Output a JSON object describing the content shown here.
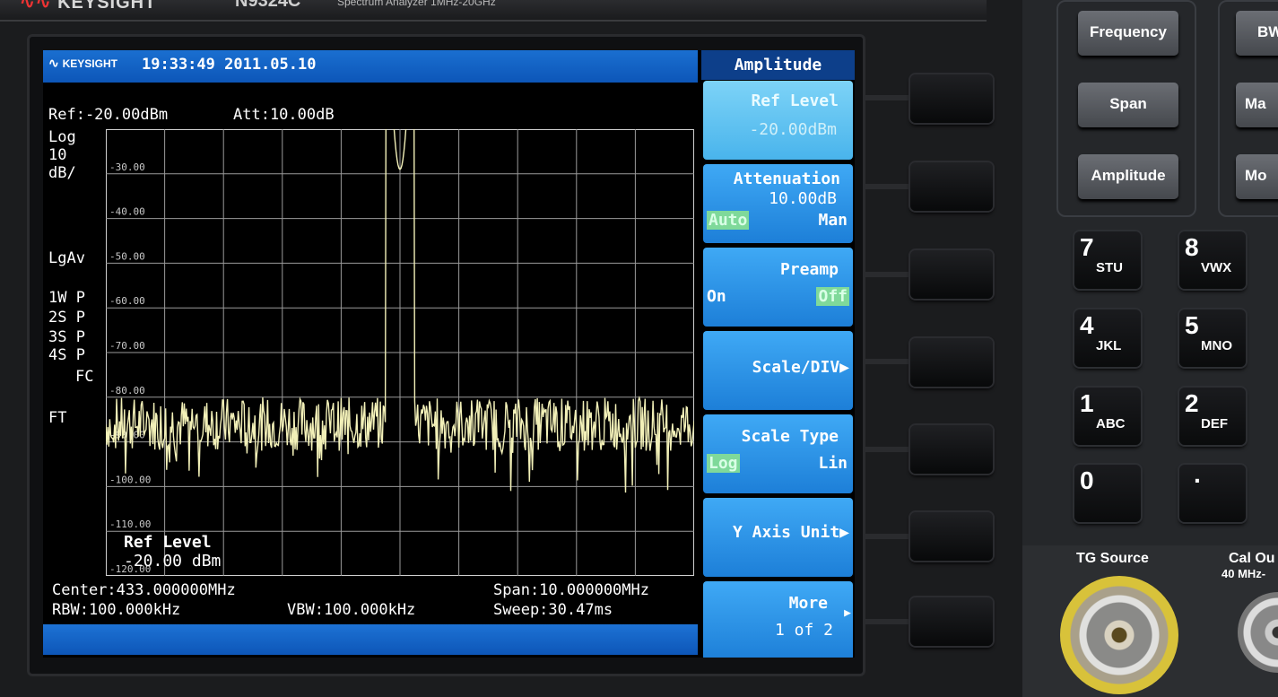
{
  "instrument": {
    "brand": "KEYSIGHT",
    "model": "N9324C",
    "subtitle": "Spectrum Analyzer  1MHz-20GHz"
  },
  "screen": {
    "logo": "KEYSIGHT",
    "clock": "19:33:49 2011.05.10",
    "ref": "Ref:-20.00dBm",
    "att": "Att:10.00dB",
    "scale_log": "Log",
    "scale_div": "10",
    "scale_unit": "dB/",
    "avg": "LgAv",
    "traces": [
      "1W P",
      "2S P",
      "3S P",
      "4S P"
    ],
    "fc": "FC",
    "ft": "FT",
    "y_ticks": [
      "-30.00",
      "-40.00",
      "-50.00",
      "-60.00",
      "-70.00",
      "-80.00",
      "-90.00",
      "-100.00",
      "-110.00",
      "-120.00"
    ],
    "ref_level_label": "Ref Level",
    "ref_level_value": "-20.00 dBm",
    "center": "Center:433.000000MHz",
    "span": "Span:10.000000MHz",
    "rbw": "RBW:100.000kHz",
    "vbw": "VBW:100.000kHz",
    "sweep": "Sweep:30.47ms"
  },
  "menu": {
    "title": "Amplitude",
    "softkeys": [
      {
        "label": "Ref Level",
        "value": "-20.00dBm"
      },
      {
        "label": "Attenuation",
        "value": "10.00dB",
        "opt_a": "Auto",
        "opt_b": "Man"
      },
      {
        "label": "Preamp",
        "opt_a": "On",
        "opt_b": "Off"
      },
      {
        "label": "Scale/DIV▶"
      },
      {
        "label": "Scale Type",
        "opt_a": "Log",
        "opt_b": "Lin"
      },
      {
        "label": "Y Axis Unit▶"
      },
      {
        "label": "More",
        "value": "1 of 2"
      }
    ]
  },
  "front_panel": {
    "func_keys": [
      "Frequency",
      "Span",
      "Amplitude"
    ],
    "func_keys_right": [
      "BW",
      "Ma",
      "Mo"
    ],
    "numpad": [
      {
        "digit": "7",
        "letters": "STU"
      },
      {
        "digit": "8",
        "letters": "VWX"
      },
      {
        "digit": "4",
        "letters": "JKL"
      },
      {
        "digit": "5",
        "letters": "MNO"
      },
      {
        "digit": "1",
        "letters": "ABC"
      },
      {
        "digit": "2",
        "letters": "DEF"
      },
      {
        "digit": "0",
        "letters": ""
      },
      {
        "digit": "·",
        "letters": ""
      }
    ],
    "tg_source": "TG Source",
    "cal_out": "Cal Ou",
    "cal_freq": "40 MHz-"
  },
  "trace": {
    "color": "#f2f0b8",
    "center_mhz": 433.0,
    "span_mhz": 10.0,
    "noise_floor_dbm": -86,
    "peak_dbm": -29
  }
}
